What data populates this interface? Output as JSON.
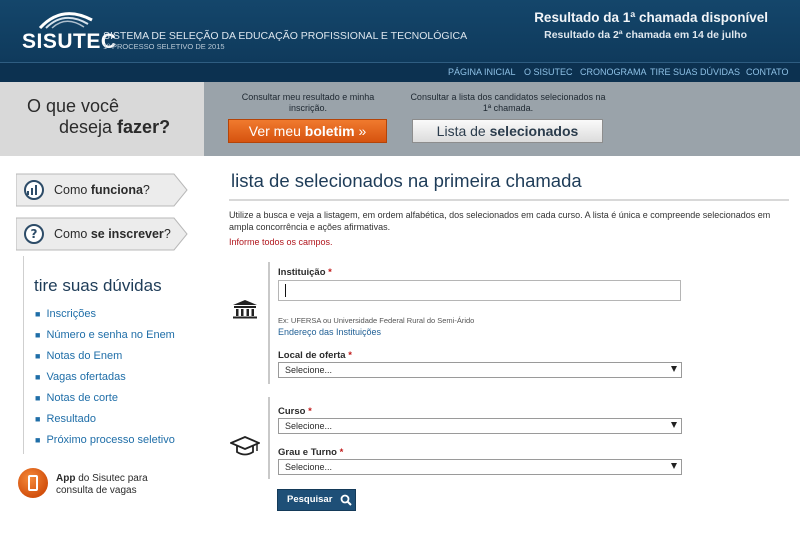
{
  "header": {
    "logo": "SISUTEC",
    "system_name": "SISTEMA DE SELEÇÃO DA EDUCAÇÃO PROFISSIONAL E TECNOLÓGICA",
    "subtitle": "1º PROCESSO SELETIVO DE 2015",
    "announcement_1": "Resultado da 1ª chamada disponível",
    "announcement_2": "Resultado da 2ª chamada em 14 de julho"
  },
  "nav": {
    "items": [
      "PÁGINA INICIAL",
      "O SISUTEC",
      "CRONOGRAMA",
      "TIRE SUAS DÚVIDAS",
      "CONTATO"
    ]
  },
  "band": {
    "question_line1": "O que você",
    "question_line2_prefix": "deseja ",
    "question_line2_bold": "fazer?",
    "boletim_caption": "Consultar meu resultado e minha inscrição.",
    "boletim_button_prefix": "Ver meu ",
    "boletim_button_bold": "boletim",
    "boletim_button_arrow": "»",
    "lista_caption": "Consultar a lista dos candidatos selecionados na 1ª chamada.",
    "lista_button_prefix": "Lista de ",
    "lista_button_bold": "selecionados"
  },
  "sidebar": {
    "tab_como_prefix": "Como ",
    "tab_como_bold": "funciona",
    "tab_como_suffix": "?",
    "tab_inscrever_prefix": "Como ",
    "tab_inscrever_bold": "se inscrever",
    "tab_inscrever_suffix": "?",
    "faq_title": "tire suas dúvidas",
    "faq_items": [
      "Inscrições",
      "Número e senha no Enem",
      "Notas do Enem",
      "Vagas ofertadas",
      "Notas de corte",
      "Resultado",
      "Próximo processo seletivo"
    ],
    "app_bold": "App",
    "app_text_1": " do Sisutec para",
    "app_text_2": "consulta de vagas"
  },
  "main": {
    "title": "lista de selecionados na primeira chamada",
    "intro": "Utilize a busca e veja a listagem, em ordem alfabética, dos selecionados em cada curso. A lista é única e compreende selecionados em ampla concorrência e ações afirmativas.",
    "required_note": "Informe todos os campos.",
    "instituicao_label": "Instituição",
    "required_mark": "*",
    "instituicao_value": "",
    "instituicao_example": "Ex: UFERSA ou Universidade Federal Rural do Semi-Árido",
    "instituicao_link": "Endereço das Instituições",
    "local_label": "Local de oferta",
    "local_selected": "Selecione...",
    "curso_label": "Curso",
    "curso_selected": "Selecione...",
    "grau_label": "Grau e Turno",
    "grau_selected": "Selecione...",
    "search_button": "Pesquisar"
  },
  "colors": {
    "header_bg": "#14466b",
    "orange_button": "#e0621a",
    "link_blue": "#1f6ea8",
    "required_red": "#b0151c"
  }
}
